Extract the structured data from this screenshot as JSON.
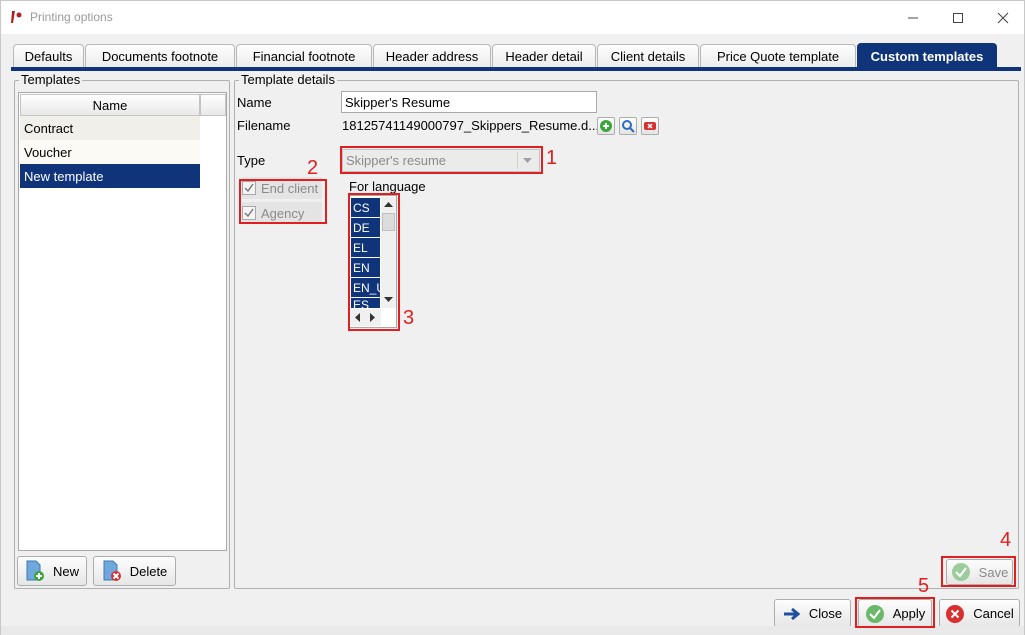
{
  "window": {
    "title": "Printing options"
  },
  "tabs": [
    {
      "label": "Defaults",
      "active": false
    },
    {
      "label": "Documents footnote",
      "active": false
    },
    {
      "label": "Financial footnote",
      "active": false
    },
    {
      "label": "Header address",
      "active": false
    },
    {
      "label": "Header detail",
      "active": false
    },
    {
      "label": "Client details",
      "active": false
    },
    {
      "label": "Price Quote template",
      "active": false
    },
    {
      "label": "Custom templates",
      "active": true
    }
  ],
  "templates": {
    "group_title": "Templates",
    "column_header": "Name",
    "rows": [
      "Contract",
      "Voucher",
      "New template"
    ],
    "selected": "New template",
    "new_button": "New",
    "delete_button": "Delete"
  },
  "details": {
    "group_title": "Template details",
    "name_label": "Name",
    "name_value": "Skipper's Resume",
    "filename_label": "Filename",
    "filename_value": "18125741149000797_Skippers_Resume.d...",
    "type_label": "Type",
    "type_value": "Skipper's resume",
    "end_client_label": "End client",
    "agency_label": "Agency",
    "language_label": "For language",
    "languages": [
      "CS",
      "DE",
      "EL",
      "EN",
      "EN_U",
      "ES"
    ]
  },
  "buttons": {
    "save": "Save",
    "close": "Close",
    "apply": "Apply",
    "cancel": "Cancel"
  },
  "annotations": [
    "1",
    "2",
    "3",
    "4",
    "5"
  ],
  "colors": {
    "accent": "#10347a",
    "annotation": "#e02020"
  }
}
